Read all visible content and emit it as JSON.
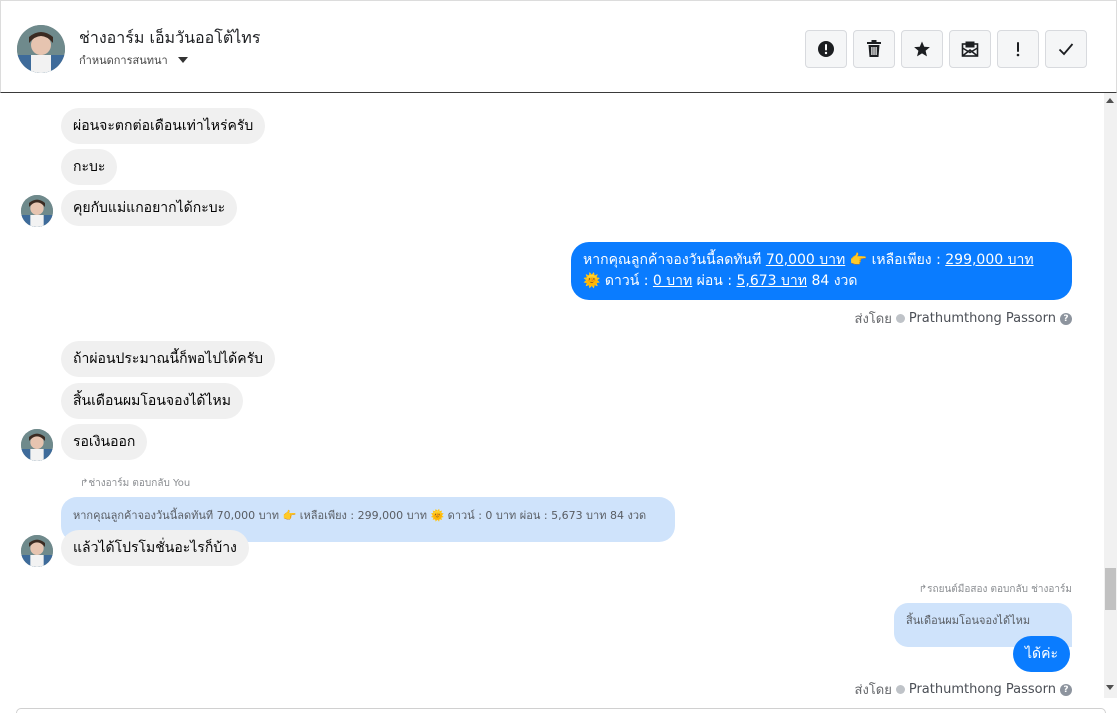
{
  "header": {
    "contact_name": "ช่างอาร์ม เอ็มวันออโต้ไทร",
    "subtitle": "กำหนดการสนทนา",
    "actions": [
      {
        "name": "report-button",
        "icon": "exclamation-circle-icon"
      },
      {
        "name": "delete-button",
        "icon": "trash-icon"
      },
      {
        "name": "star-button",
        "icon": "star-icon"
      },
      {
        "name": "mark-unread-button",
        "icon": "envelope-icon"
      },
      {
        "name": "important-button",
        "icon": "exclamation-icon"
      },
      {
        "name": "done-button",
        "icon": "check-icon"
      }
    ]
  },
  "messages": {
    "in1": "ผ่อนจะตกต่อเดือนเท่าไหร่ครับ",
    "in2": "กะบะ",
    "in3": "คุยกับแม่แกอยากได้กะบะ",
    "out1": {
      "line1_pre": "หากคุณลูกค้าจองวันนี้ลดทันที ",
      "discount": "70,000 บาท",
      "line1_mid": " 👉 เหลือเพียง : ",
      "price": "299,000 บาท",
      "line2_pre": "🌞 ดาวน์ : ",
      "down": "0 บาท",
      "line2_mid": " ผ่อน : ",
      "installment": "5,673 บาท",
      "line2_post": " 84 งวด"
    },
    "sent_by_label": "ส่งโดย",
    "sent_by_name": "Prathumthong Passorn",
    "help_glyph": "?",
    "in4": "ถ้าผ่อนประมาณนี้ก็พอไปได้ครับ",
    "in5": "สิ้นเดือนผมโอนจองได้ไหม",
    "in6": "รอเงินออก",
    "reply_note_in": "↱ช่างอาร์ม ตอบกลับ You",
    "quote_in": "หากคุณลูกค้าจองวันนี้ลดทันที 70,000 บาท 👉 เหลือเพียง : 299,000 บาท 🌞 ดาวน์ : 0 บาท ผ่อน : 5,673 บาท 84 งวด",
    "in7": "แล้วได้โปรโมชั่นอะไรก็บ้าง",
    "reply_note_out": "↱รถยนต์มือสอง ตอบกลับ ช่างอาร์ม",
    "quote_out": "สิ้นเดือนผมโอนจองได้ไหม",
    "out2": "ได้ค่ะ"
  },
  "colors": {
    "outgoing": "#0a7cff",
    "incoming": "#f0f0f0",
    "quote": "#cfe3fb"
  }
}
